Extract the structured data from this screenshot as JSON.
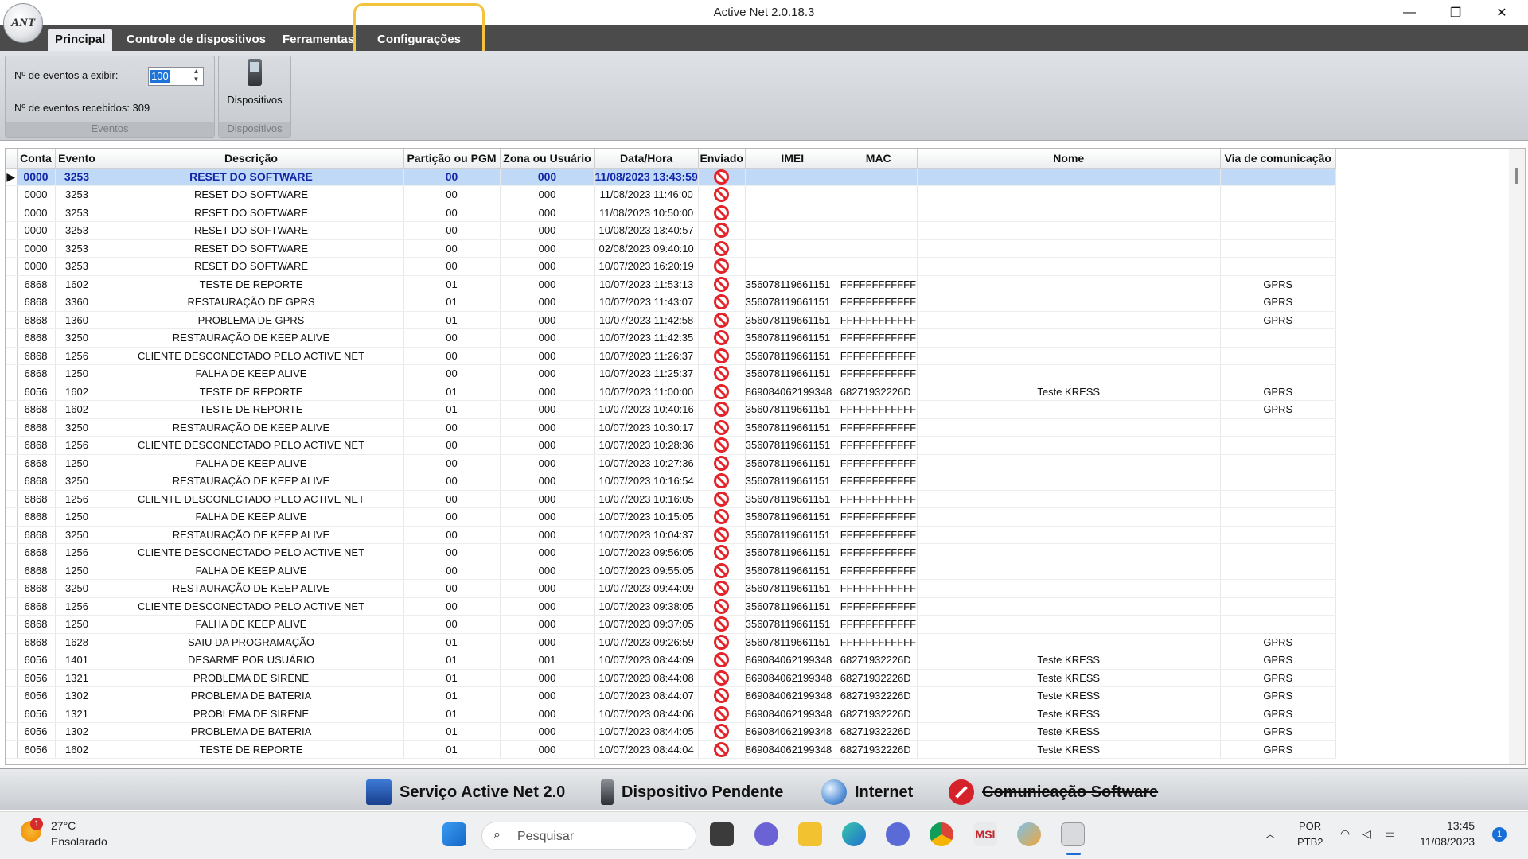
{
  "window": {
    "title": "Active Net 2.0.18.3",
    "logo_text": "ANT",
    "minimize_glyph": "—",
    "restore_glyph": "❐",
    "close_glyph": "✕"
  },
  "ribbon": {
    "tabs": [
      {
        "label": "Principal",
        "active": true
      },
      {
        "label": "Controle de dispositivos",
        "active": false
      },
      {
        "label": "Ferramentas",
        "active": false
      },
      {
        "label": "Configurações",
        "active": false
      }
    ],
    "eventos_group": {
      "exibir_label": "Nº de eventos a exibir:",
      "exibir_value": "100",
      "recebidos_label": "Nº de eventos recebidos: 309",
      "group_label": "Eventos"
    },
    "dispositivos_group": {
      "button_label": "Dispositivos",
      "group_label": "Dispositivos"
    }
  },
  "grid": {
    "columns": [
      "Conta",
      "Evento",
      "Descrição",
      "Partição ou PGM",
      "Zona ou Usuário",
      "Data/Hora",
      "Enviado",
      "IMEI",
      "MAC",
      "Nome",
      "Via de comunicação"
    ],
    "rows": [
      {
        "conta": "0000",
        "evento": "3253",
        "descricao": "RESET DO SOFTWARE",
        "particao": "00",
        "zona": "000",
        "data": "11/08/2023 13:43:59",
        "imei": "",
        "mac": "",
        "nome": "",
        "via": "",
        "selected": true
      },
      {
        "conta": "0000",
        "evento": "3253",
        "descricao": "RESET DO SOFTWARE",
        "particao": "00",
        "zona": "000",
        "data": "11/08/2023 11:46:00",
        "imei": "",
        "mac": "",
        "nome": "",
        "via": ""
      },
      {
        "conta": "0000",
        "evento": "3253",
        "descricao": "RESET DO SOFTWARE",
        "particao": "00",
        "zona": "000",
        "data": "11/08/2023 10:50:00",
        "imei": "",
        "mac": "",
        "nome": "",
        "via": ""
      },
      {
        "conta": "0000",
        "evento": "3253",
        "descricao": "RESET DO SOFTWARE",
        "particao": "00",
        "zona": "000",
        "data": "10/08/2023 13:40:57",
        "imei": "",
        "mac": "",
        "nome": "",
        "via": ""
      },
      {
        "conta": "0000",
        "evento": "3253",
        "descricao": "RESET DO SOFTWARE",
        "particao": "00",
        "zona": "000",
        "data": "02/08/2023 09:40:10",
        "imei": "",
        "mac": "",
        "nome": "",
        "via": ""
      },
      {
        "conta": "0000",
        "evento": "3253",
        "descricao": "RESET DO SOFTWARE",
        "particao": "00",
        "zona": "000",
        "data": "10/07/2023 16:20:19",
        "imei": "",
        "mac": "",
        "nome": "",
        "via": ""
      },
      {
        "conta": "6868",
        "evento": "1602",
        "descricao": "TESTE DE REPORTE",
        "particao": "01",
        "zona": "000",
        "data": "10/07/2023 11:53:13",
        "imei": "356078119661151",
        "mac": "FFFFFFFFFFFF",
        "nome": "",
        "via": "GPRS"
      },
      {
        "conta": "6868",
        "evento": "3360",
        "descricao": "RESTAURAÇÃO DE GPRS",
        "particao": "01",
        "zona": "000",
        "data": "10/07/2023 11:43:07",
        "imei": "356078119661151",
        "mac": "FFFFFFFFFFFF",
        "nome": "",
        "via": "GPRS"
      },
      {
        "conta": "6868",
        "evento": "1360",
        "descricao": "PROBLEMA DE GPRS",
        "particao": "01",
        "zona": "000",
        "data": "10/07/2023 11:42:58",
        "imei": "356078119661151",
        "mac": "FFFFFFFFFFFF",
        "nome": "",
        "via": "GPRS"
      },
      {
        "conta": "6868",
        "evento": "3250",
        "descricao": "RESTAURAÇÃO DE KEEP ALIVE",
        "particao": "00",
        "zona": "000",
        "data": "10/07/2023 11:42:35",
        "imei": "356078119661151",
        "mac": "FFFFFFFFFFFF",
        "nome": "",
        "via": ""
      },
      {
        "conta": "6868",
        "evento": "1256",
        "descricao": "CLIENTE DESCONECTADO PELO ACTIVE NET",
        "particao": "00",
        "zona": "000",
        "data": "10/07/2023 11:26:37",
        "imei": "356078119661151",
        "mac": "FFFFFFFFFFFF",
        "nome": "",
        "via": ""
      },
      {
        "conta": "6868",
        "evento": "1250",
        "descricao": "FALHA DE KEEP ALIVE",
        "particao": "00",
        "zona": "000",
        "data": "10/07/2023 11:25:37",
        "imei": "356078119661151",
        "mac": "FFFFFFFFFFFF",
        "nome": "",
        "via": ""
      },
      {
        "conta": "6056",
        "evento": "1602",
        "descricao": "TESTE DE REPORTE",
        "particao": "01",
        "zona": "000",
        "data": "10/07/2023 11:00:00",
        "imei": "869084062199348",
        "mac": "68271932226D",
        "nome": "Teste KRESS",
        "via": "GPRS"
      },
      {
        "conta": "6868",
        "evento": "1602",
        "descricao": "TESTE DE REPORTE",
        "particao": "01",
        "zona": "000",
        "data": "10/07/2023 10:40:16",
        "imei": "356078119661151",
        "mac": "FFFFFFFFFFFF",
        "nome": "",
        "via": "GPRS"
      },
      {
        "conta": "6868",
        "evento": "3250",
        "descricao": "RESTAURAÇÃO DE KEEP ALIVE",
        "particao": "00",
        "zona": "000",
        "data": "10/07/2023 10:30:17",
        "imei": "356078119661151",
        "mac": "FFFFFFFFFFFF",
        "nome": "",
        "via": ""
      },
      {
        "conta": "6868",
        "evento": "1256",
        "descricao": "CLIENTE DESCONECTADO PELO ACTIVE NET",
        "particao": "00",
        "zona": "000",
        "data": "10/07/2023 10:28:36",
        "imei": "356078119661151",
        "mac": "FFFFFFFFFFFF",
        "nome": "",
        "via": ""
      },
      {
        "conta": "6868",
        "evento": "1250",
        "descricao": "FALHA DE KEEP ALIVE",
        "particao": "00",
        "zona": "000",
        "data": "10/07/2023 10:27:36",
        "imei": "356078119661151",
        "mac": "FFFFFFFFFFFF",
        "nome": "",
        "via": ""
      },
      {
        "conta": "6868",
        "evento": "3250",
        "descricao": "RESTAURAÇÃO DE KEEP ALIVE",
        "particao": "00",
        "zona": "000",
        "data": "10/07/2023 10:16:54",
        "imei": "356078119661151",
        "mac": "FFFFFFFFFFFF",
        "nome": "",
        "via": ""
      },
      {
        "conta": "6868",
        "evento": "1256",
        "descricao": "CLIENTE DESCONECTADO PELO ACTIVE NET",
        "particao": "00",
        "zona": "000",
        "data": "10/07/2023 10:16:05",
        "imei": "356078119661151",
        "mac": "FFFFFFFFFFFF",
        "nome": "",
        "via": ""
      },
      {
        "conta": "6868",
        "evento": "1250",
        "descricao": "FALHA DE KEEP ALIVE",
        "particao": "00",
        "zona": "000",
        "data": "10/07/2023 10:15:05",
        "imei": "356078119661151",
        "mac": "FFFFFFFFFFFF",
        "nome": "",
        "via": ""
      },
      {
        "conta": "6868",
        "evento": "3250",
        "descricao": "RESTAURAÇÃO DE KEEP ALIVE",
        "particao": "00",
        "zona": "000",
        "data": "10/07/2023 10:04:37",
        "imei": "356078119661151",
        "mac": "FFFFFFFFFFFF",
        "nome": "",
        "via": ""
      },
      {
        "conta": "6868",
        "evento": "1256",
        "descricao": "CLIENTE DESCONECTADO PELO ACTIVE NET",
        "particao": "00",
        "zona": "000",
        "data": "10/07/2023 09:56:05",
        "imei": "356078119661151",
        "mac": "FFFFFFFFFFFF",
        "nome": "",
        "via": ""
      },
      {
        "conta": "6868",
        "evento": "1250",
        "descricao": "FALHA DE KEEP ALIVE",
        "particao": "00",
        "zona": "000",
        "data": "10/07/2023 09:55:05",
        "imei": "356078119661151",
        "mac": "FFFFFFFFFFFF",
        "nome": "",
        "via": ""
      },
      {
        "conta": "6868",
        "evento": "3250",
        "descricao": "RESTAURAÇÃO DE KEEP ALIVE",
        "particao": "00",
        "zona": "000",
        "data": "10/07/2023 09:44:09",
        "imei": "356078119661151",
        "mac": "FFFFFFFFFFFF",
        "nome": "",
        "via": ""
      },
      {
        "conta": "6868",
        "evento": "1256",
        "descricao": "CLIENTE DESCONECTADO PELO ACTIVE NET",
        "particao": "00",
        "zona": "000",
        "data": "10/07/2023 09:38:05",
        "imei": "356078119661151",
        "mac": "FFFFFFFFFFFF",
        "nome": "",
        "via": ""
      },
      {
        "conta": "6868",
        "evento": "1250",
        "descricao": "FALHA DE KEEP ALIVE",
        "particao": "00",
        "zona": "000",
        "data": "10/07/2023 09:37:05",
        "imei": "356078119661151",
        "mac": "FFFFFFFFFFFF",
        "nome": "",
        "via": ""
      },
      {
        "conta": "6868",
        "evento": "1628",
        "descricao": "SAIU DA PROGRAMAÇÃO",
        "particao": "01",
        "zona": "000",
        "data": "10/07/2023 09:26:59",
        "imei": "356078119661151",
        "mac": "FFFFFFFFFFFF",
        "nome": "",
        "via": "GPRS"
      },
      {
        "conta": "6056",
        "evento": "1401",
        "descricao": "DESARME POR USUÁRIO",
        "particao": "01",
        "zona": "001",
        "data": "10/07/2023 08:44:09",
        "imei": "869084062199348",
        "mac": "68271932226D",
        "nome": "Teste KRESS",
        "via": "GPRS"
      },
      {
        "conta": "6056",
        "evento": "1321",
        "descricao": "PROBLEMA DE SIRENE",
        "particao": "01",
        "zona": "000",
        "data": "10/07/2023 08:44:08",
        "imei": "869084062199348",
        "mac": "68271932226D",
        "nome": "Teste KRESS",
        "via": "GPRS"
      },
      {
        "conta": "6056",
        "evento": "1302",
        "descricao": "PROBLEMA DE BATERIA",
        "particao": "01",
        "zona": "000",
        "data": "10/07/2023 08:44:07",
        "imei": "869084062199348",
        "mac": "68271932226D",
        "nome": "Teste KRESS",
        "via": "GPRS"
      },
      {
        "conta": "6056",
        "evento": "1321",
        "descricao": "PROBLEMA DE SIRENE",
        "particao": "01",
        "zona": "000",
        "data": "10/07/2023 08:44:06",
        "imei": "869084062199348",
        "mac": "68271932226D",
        "nome": "Teste KRESS",
        "via": "GPRS"
      },
      {
        "conta": "6056",
        "evento": "1302",
        "descricao": "PROBLEMA DE BATERIA",
        "particao": "01",
        "zona": "000",
        "data": "10/07/2023 08:44:05",
        "imei": "869084062199348",
        "mac": "68271932226D",
        "nome": "Teste KRESS",
        "via": "GPRS"
      },
      {
        "conta": "6056",
        "evento": "1602",
        "descricao": "TESTE DE REPORTE",
        "particao": "01",
        "zona": "000",
        "data": "10/07/2023 08:44:04",
        "imei": "869084062199348",
        "mac": "68271932226D",
        "nome": "Teste KRESS",
        "via": "GPRS"
      }
    ]
  },
  "statusbar": {
    "servico": "Serviço Active Net 2.0",
    "dispositivo": "Dispositivo Pendente",
    "internet": "Internet",
    "comunicacao": "Comunicação Software"
  },
  "taskbar": {
    "temperature": "27°C",
    "weather": "Ensolarado",
    "weather_badge": "1",
    "search_placeholder": "Pesquisar",
    "language": "POR",
    "layout": "PTB2",
    "time": "13:45",
    "date": "11/08/2023",
    "notification_count": "1"
  },
  "colors": {
    "tab_strip": "#4b4b4b",
    "highlight": "#f4c33d",
    "selected_row": "#bfd9f6",
    "not_sent_icon": "#e3252b"
  }
}
